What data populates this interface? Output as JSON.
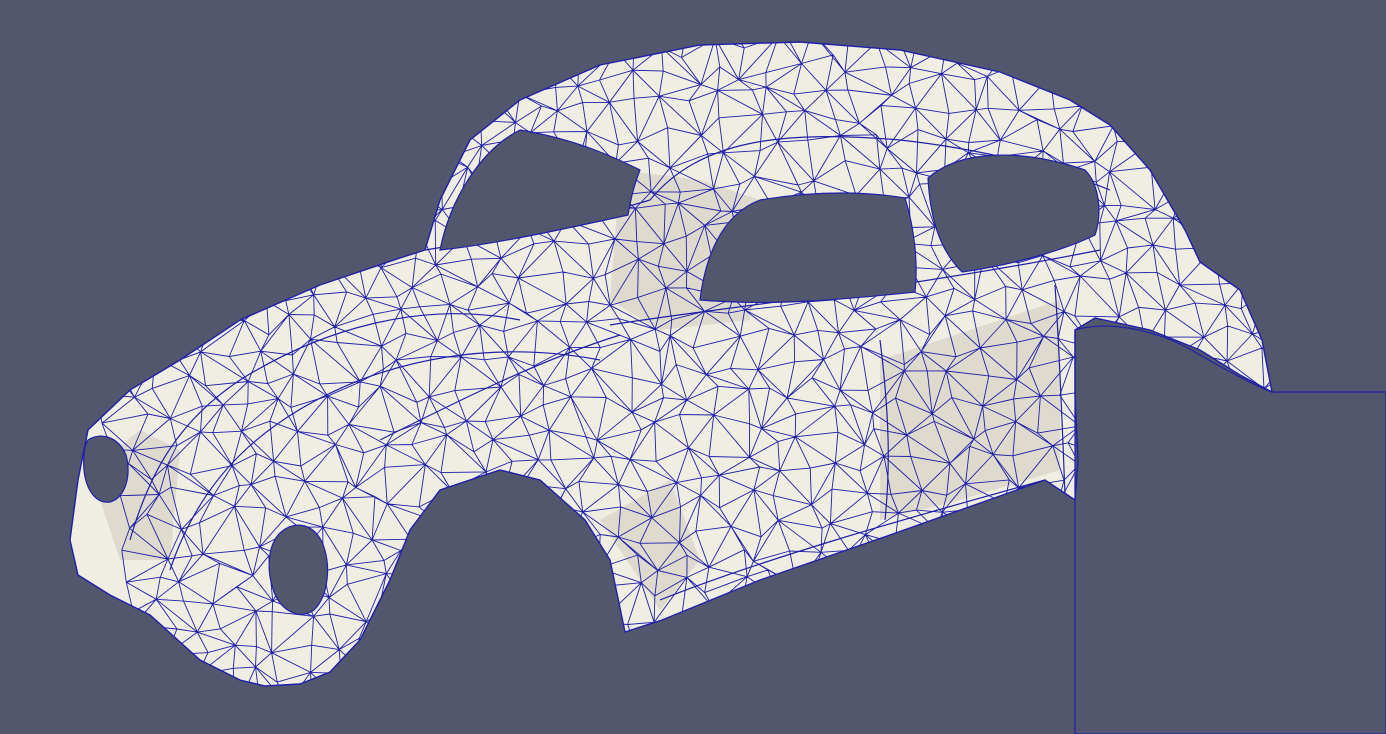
{
  "viewport": {
    "background_color": "#52576e",
    "surface_color": "#f0ede2",
    "shade_color": "#cfcbbd",
    "wireframe_color": "#1f1fa8",
    "cutout_color": "#52576e",
    "render_mode": "surface-with-edges",
    "model": "vw-beetle-body-shell"
  }
}
